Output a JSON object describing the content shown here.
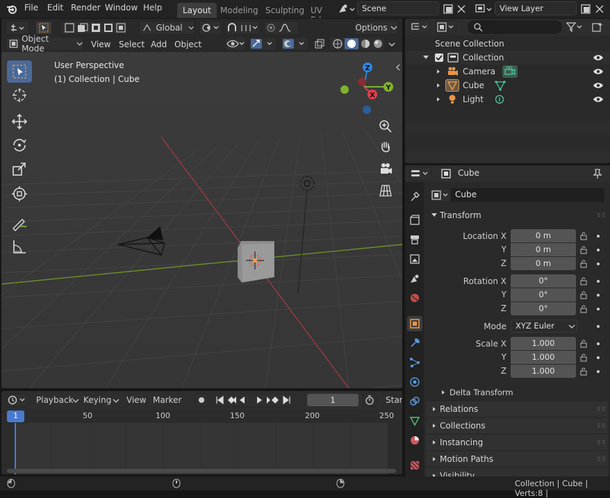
{
  "menus": [
    "File",
    "Edit",
    "Render",
    "Window",
    "Help"
  ],
  "workspaces": [
    "Layout",
    "Modeling",
    "Sculpting",
    "UV Ed"
  ],
  "active_workspace": "Layout",
  "scene": {
    "name": "Scene"
  },
  "view_layer": {
    "name": "View Layer"
  },
  "viewport": {
    "transform_orientation": "Global",
    "options_label": "Options",
    "mode": "Object Mode",
    "header_menus": [
      "View",
      "Select",
      "Add",
      "Object"
    ],
    "overlay_title": "User Perspective",
    "overlay_subtitle": "(1) Collection | Cube",
    "gizmo": {
      "x": "X",
      "y": "Y",
      "z": "Z"
    }
  },
  "timeline": {
    "menus": [
      "Playback",
      "Keying",
      "View",
      "Marker"
    ],
    "current_frame": "1",
    "start_label": "Start",
    "ruler": [
      "1",
      "50",
      "100",
      "150",
      "200",
      "250"
    ]
  },
  "outliner": {
    "root": "Scene Collection",
    "collection": "Collection",
    "objects": [
      "Camera",
      "Cube",
      "Light"
    ]
  },
  "properties": {
    "context_name": "Cube",
    "object_name": "Cube",
    "transform_panel": "Transform",
    "location_label": "Location X",
    "rotation_label": "Rotation X",
    "scale_label": "Scale X",
    "y_label": "Y",
    "z_label": "Z",
    "mode_label": "Mode",
    "location": [
      "0 m",
      "0 m",
      "0 m"
    ],
    "rotation": [
      "0°",
      "0°",
      "0°"
    ],
    "scale": [
      "1.000",
      "1.000",
      "1.000"
    ],
    "rotation_mode": "XYZ Euler",
    "delta_transform": "Delta Transform",
    "panels": [
      "Relations",
      "Collections",
      "Instancing",
      "Motion Paths",
      "Visibility"
    ]
  },
  "status": {
    "text": "Collection | Cube | Verts:8 |"
  },
  "colors": {
    "accent": "#4a6a9a",
    "axis_x": "#e0404c",
    "axis_y": "#7fb32c",
    "axis_z": "#2f86e0",
    "origin": "#ff9f2a"
  }
}
